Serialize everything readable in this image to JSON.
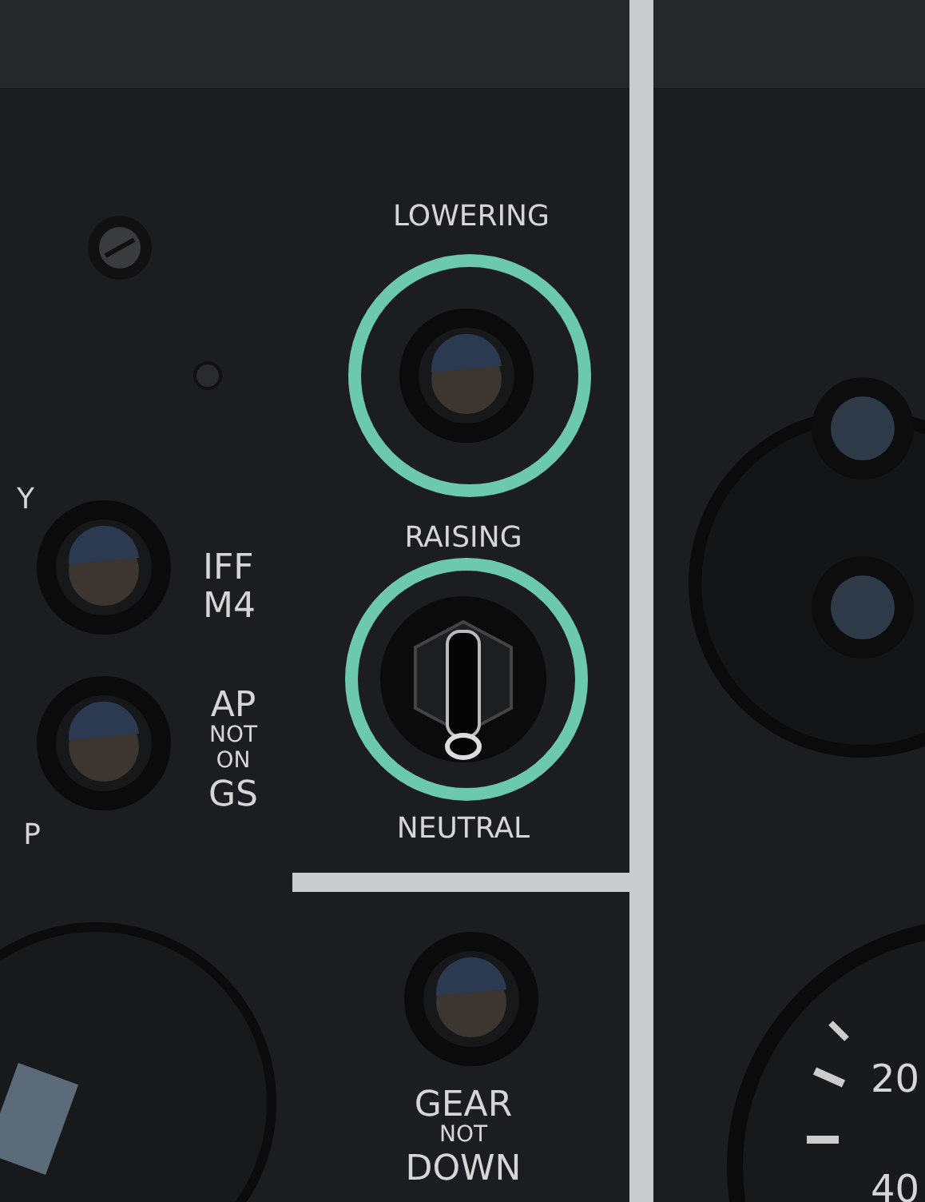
{
  "side_labels": [
    "Y",
    "P"
  ],
  "controls": [
    {
      "kind": "light",
      "highlighted": false,
      "caption": [
        {
          "text": "IFF",
          "kind": "large"
        },
        {
          "text": "M4",
          "kind": "large"
        }
      ]
    },
    {
      "kind": "light",
      "highlighted": false,
      "caption": [
        {
          "text": "AP",
          "kind": "large"
        },
        {
          "text": "NOT",
          "kind": "small"
        },
        {
          "text": "ON",
          "kind": "small"
        },
        {
          "text": "GS",
          "kind": "large"
        }
      ]
    },
    {
      "kind": "light",
      "highlighted": true,
      "caption": [
        {
          "text": "LOWERING",
          "kind": "medium"
        }
      ]
    },
    {
      "kind": "toggle",
      "highlighted": true,
      "on": false,
      "caption": [
        {
          "text": "RAISING",
          "kind": "medium"
        }
      ],
      "caption_below": [
        {
          "text": "NEUTRAL",
          "kind": "medium"
        }
      ]
    },
    {
      "kind": "light",
      "highlighted": false,
      "caption": [
        {
          "text": "GEAR",
          "kind": "large"
        },
        {
          "text": "NOT",
          "kind": "small"
        },
        {
          "text": "DOWN",
          "kind": "large"
        }
      ]
    }
  ],
  "gauge_labels": [
    "20",
    "40"
  ]
}
